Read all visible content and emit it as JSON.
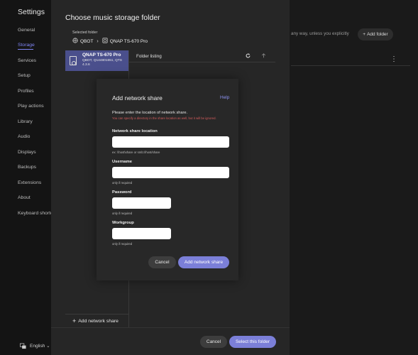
{
  "sidebar": {
    "title": "Settings",
    "items": [
      {
        "label": "General"
      },
      {
        "label": "Storage"
      },
      {
        "label": "Services"
      },
      {
        "label": "Setup"
      },
      {
        "label": "Profiles"
      },
      {
        "label": "Play actions"
      },
      {
        "label": "Library"
      },
      {
        "label": "Audio"
      },
      {
        "label": "Displays"
      },
      {
        "label": "Backups"
      },
      {
        "label": "Extensions"
      },
      {
        "label": "About"
      },
      {
        "label": "Keyboard shortcu"
      }
    ],
    "language": "English ⌄"
  },
  "background": {
    "partial_text": "any way, unless you explicitly",
    "add_folder_label": "Add folder"
  },
  "folder_dialog": {
    "title": "Choose music storage folder",
    "selected_label": "Selected folder",
    "breadcrumb": [
      "QBOT",
      "QNAP TS-670 Pro"
    ],
    "device": {
      "name": "QNAP TS-670 Pro",
      "detail": "QBOT, Q144801651, QTS 4.3.6"
    },
    "listing_label": "Folder listing",
    "add_network_share_label": "Add network share",
    "cancel_label": "Cancel",
    "select_label": "Select this folder"
  },
  "share_dialog": {
    "title": "Add network share",
    "help_label": "Help",
    "prompt": "Please enter the location of network share.",
    "warning": "You can specify a directory in the share location as well, but it will be ignored.",
    "location_label": "Network share location",
    "location_hint": "ex: \\\\host\\share or smb://host/share",
    "username_label": "Username",
    "username_hint": "only if required",
    "password_label": "Password",
    "password_hint": "only if required",
    "workgroup_label": "Workgroup",
    "workgroup_hint": "only if required",
    "cancel_label": "Cancel",
    "submit_label": "Add network share"
  },
  "colors": {
    "accent": "#7b7fd8",
    "active_nav": "#7f85f5",
    "device_card": "#4a4f8c",
    "warning": "#d45c5c"
  }
}
